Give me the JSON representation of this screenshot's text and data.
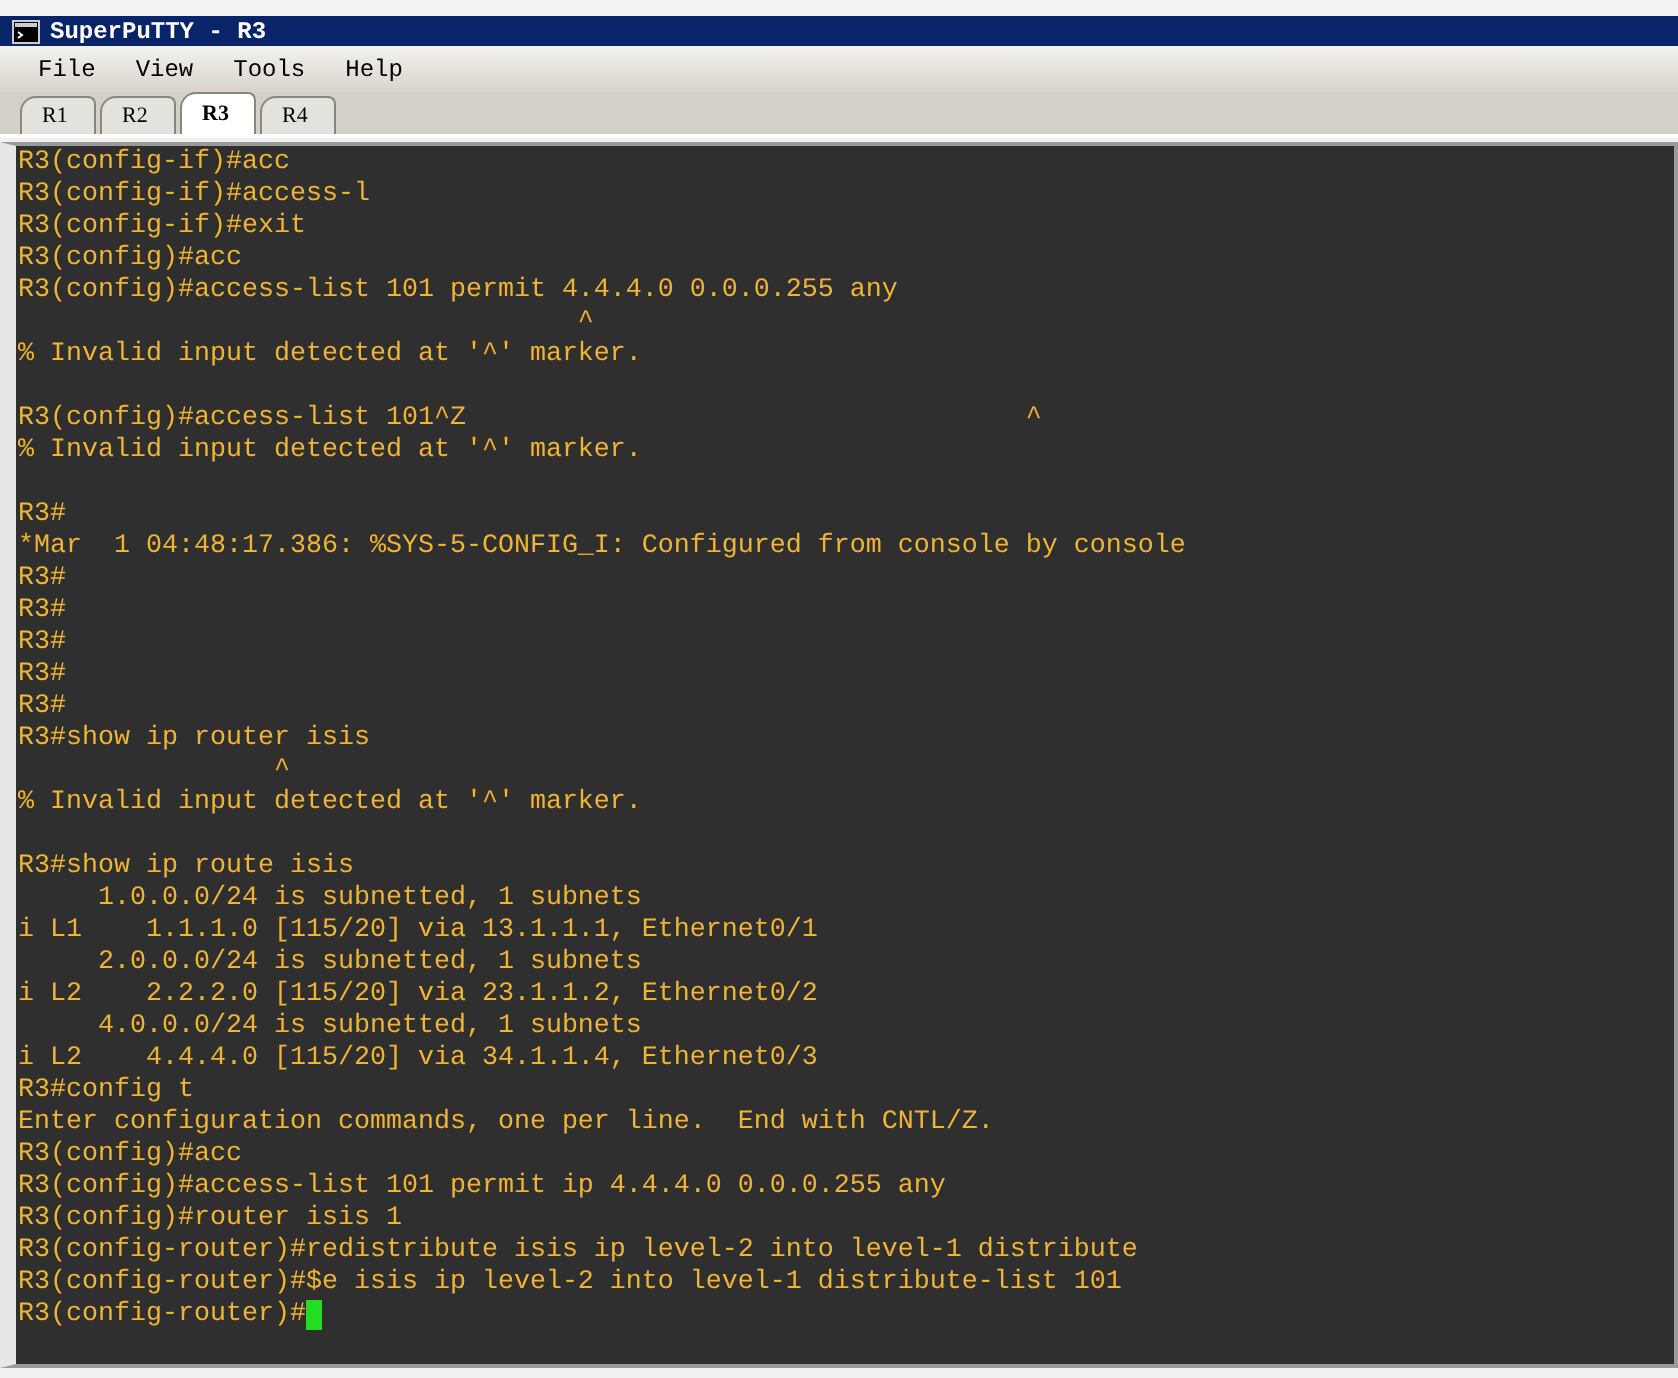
{
  "window": {
    "title": "SuperPuTTY - R3"
  },
  "menu": [
    "File",
    "View",
    "Tools",
    "Help"
  ],
  "tabs": [
    {
      "label": "R1",
      "selected": false
    },
    {
      "label": "R2",
      "selected": false
    },
    {
      "label": "R3",
      "selected": true
    },
    {
      "label": "R4",
      "selected": false
    }
  ],
  "terminal": {
    "blocks": [
      {
        "lines": [
          "R3(config-if)#acc",
          "R3(config-if)#access-l",
          "R3(config-if)#exit",
          "R3(config)#acc",
          "R3(config)#access-list 101 permit 4.4.4.0 0.0.0.255 any",
          "                                   ^",
          "% Invalid input detected at '^' marker."
        ]
      },
      {
        "lines": [
          "R3(config)#access-list 101^Z                                   ^",
          "% Invalid input detected at '^' marker."
        ]
      },
      {
        "lines": [
          "R3#",
          "*Mar  1 04:48:17.386: %SYS-5-CONFIG_I: Configured from console by console",
          "R3#",
          "R3#",
          "R3#",
          "R3#",
          "R3#",
          "R3#show ip router isis",
          "                ^",
          "% Invalid input detected at '^' marker."
        ]
      },
      {
        "lines": [
          "R3#show ip route isis",
          "     1.0.0.0/24 is subnetted, 1 subnets",
          "i L1    1.1.1.0 [115/20] via 13.1.1.1, Ethernet0/1",
          "     2.0.0.0/24 is subnetted, 1 subnets",
          "i L2    2.2.2.0 [115/20] via 23.1.1.2, Ethernet0/2",
          "     4.0.0.0/24 is subnetted, 1 subnets",
          "i L2    4.4.4.0 [115/20] via 34.1.1.4, Ethernet0/3",
          "R3#config t",
          "Enter configuration commands, one per line.  End with CNTL/Z.",
          "R3(config)#acc",
          "R3(config)#access-list 101 permit ip 4.4.4.0 0.0.0.255 any",
          "R3(config)#router isis 1",
          "R3(config-router)#redistribute isis ip level-2 into level-1 distribute",
          "R3(config-router)#$e isis ip level-2 into level-1 distribute-list 101",
          "R3(config-router)#"
        ],
        "cursor": true
      }
    ]
  }
}
